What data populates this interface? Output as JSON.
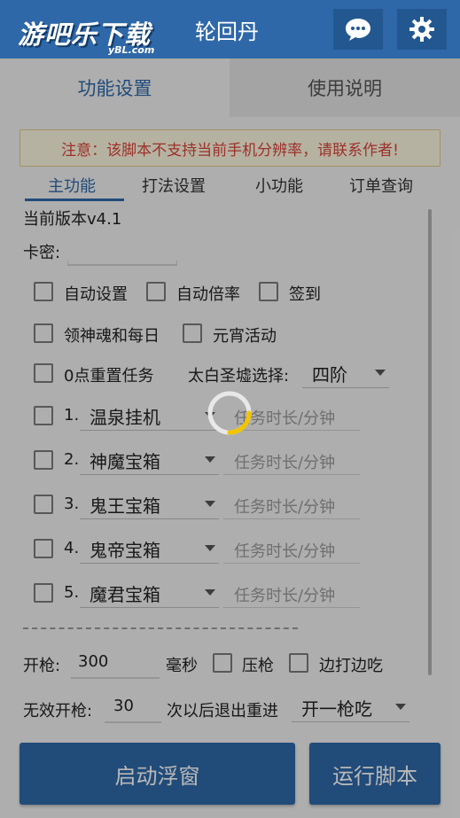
{
  "header": {
    "logo_main": "游吧乐下载",
    "logo_sub": "yBL.com",
    "title": "轮回丹",
    "chat_icon": "chat-bubble-icon",
    "settings_icon": "gear-icon"
  },
  "tabs": {
    "function_settings": "功能设置",
    "instructions": "使用说明"
  },
  "notice": "注意：该脚本不支持当前手机分辨率，请联系作者!",
  "subtabs": {
    "main": "主功能",
    "combat": "打法设置",
    "small": "小功能",
    "orders": "订单查询"
  },
  "version": "当前版本v4.1",
  "card_key": {
    "label": "卡密:",
    "value": ""
  },
  "options": {
    "auto_settings": "自动设置",
    "auto_multiplier": "自动倍率",
    "checkin": "签到",
    "claim_daily": "领神魂和每日",
    "lantern_event": "元宵活动",
    "reset_tasks": "0点重置任务",
    "ruins_label": "太白圣墟选择:",
    "ruins_value": "四阶"
  },
  "tasks": [
    {
      "num": "1.",
      "name": "温泉挂机",
      "placeholder": "任务时长/分钟"
    },
    {
      "num": "2.",
      "name": "神魔宝箱",
      "placeholder": "任务时长/分钟"
    },
    {
      "num": "3.",
      "name": "鬼王宝箱",
      "placeholder": "任务时长/分钟"
    },
    {
      "num": "4.",
      "name": "鬼帝宝箱",
      "placeholder": "任务时长/分钟"
    },
    {
      "num": "5.",
      "name": "魔君宝箱",
      "placeholder": "任务时长/分钟"
    }
  ],
  "fire": {
    "label": "开枪:",
    "value": "300",
    "unit": "毫秒",
    "press_gun": "压枪",
    "eat_while_fighting": "边打边吃"
  },
  "invalid_fire": {
    "label": "无效开枪:",
    "value": "30",
    "suffix": "次以后退出重进",
    "select_value": "开一枪吃"
  },
  "buttons": {
    "start_float": "启动浮窗",
    "run_script": "运行脚本"
  },
  "colors": {
    "primary": "#2f68a8",
    "notice_text": "#d9443a",
    "notice_bg": "#fdf7e0",
    "spinner": "#f2c400"
  }
}
